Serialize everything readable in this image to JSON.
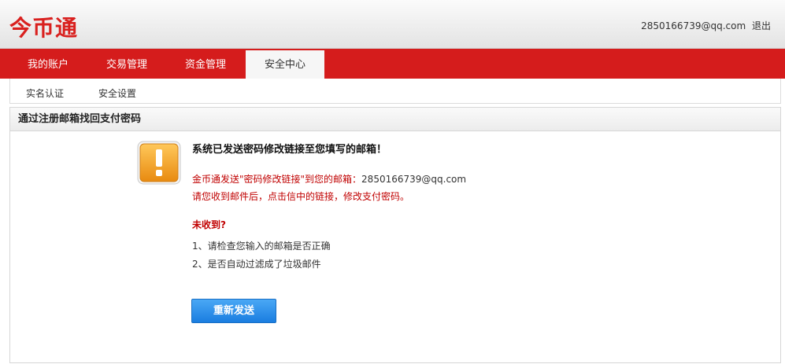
{
  "header": {
    "logo_text": "今币通",
    "user_email": "2850166739@qq.com",
    "logout_label": "退出"
  },
  "nav": {
    "items": [
      {
        "label": "我的账户"
      },
      {
        "label": "交易管理"
      },
      {
        "label": "资金管理"
      },
      {
        "label": "安全中心"
      }
    ],
    "active": "安全中心"
  },
  "subnav": {
    "items": [
      {
        "label": "实名认证"
      },
      {
        "label": "安全设置"
      }
    ]
  },
  "panel": {
    "title": "通过注册邮箱找回支付密码",
    "icon": "warning-exclamation-icon",
    "message_title": "系统已发送密码修改链接至您填写的邮箱！",
    "sent_prefix": "金币通发送\"密码修改链接\"到您的邮箱：",
    "sent_email": "2850166739@qq.com",
    "instruction": "请您收到邮件后，点击信中的链接，修改支付密码。",
    "not_received_label": "未收到?",
    "tips": [
      "1、请检查您输入的邮箱是否正确",
      "2、是否自动过滤成了垃圾邮件"
    ],
    "resend_label": "重新发送"
  },
  "colors": {
    "brand_red": "#d51c1c",
    "warning_orange": "#f0a020",
    "button_blue": "#1a7de0"
  }
}
